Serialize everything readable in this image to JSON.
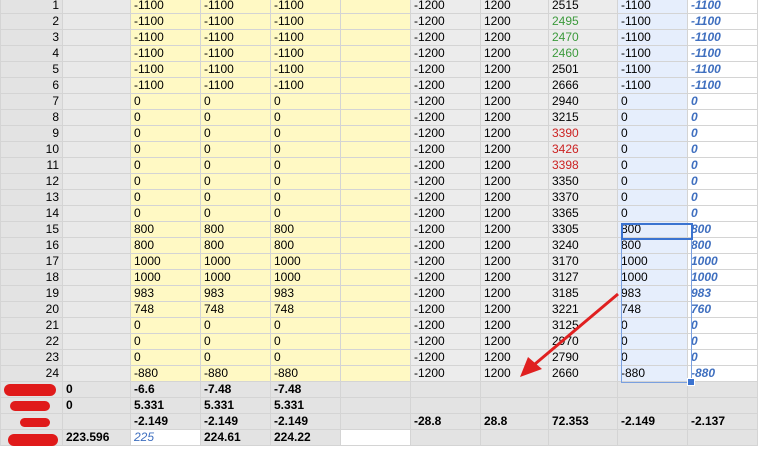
{
  "rows": [
    {
      "n": "1",
      "a": "-1100",
      "b": "-1100",
      "c": "-1100",
      "e": "-1200",
      "f": "1200",
      "g": "2515",
      "gc": "",
      "h": "-1100",
      "i": "-1100"
    },
    {
      "n": "2",
      "a": "-1100",
      "b": "-1100",
      "c": "-1100",
      "e": "-1200",
      "f": "1200",
      "g": "2495",
      "gc": "green",
      "h": "-1100",
      "i": "-1100"
    },
    {
      "n": "3",
      "a": "-1100",
      "b": "-1100",
      "c": "-1100",
      "e": "-1200",
      "f": "1200",
      "g": "2470",
      "gc": "green",
      "h": "-1100",
      "i": "-1100"
    },
    {
      "n": "4",
      "a": "-1100",
      "b": "-1100",
      "c": "-1100",
      "e": "-1200",
      "f": "1200",
      "g": "2460",
      "gc": "green",
      "h": "-1100",
      "i": "-1100"
    },
    {
      "n": "5",
      "a": "-1100",
      "b": "-1100",
      "c": "-1100",
      "e": "-1200",
      "f": "1200",
      "g": "2501",
      "gc": "",
      "h": "-1100",
      "i": "-1100"
    },
    {
      "n": "6",
      "a": "-1100",
      "b": "-1100",
      "c": "-1100",
      "e": "-1200",
      "f": "1200",
      "g": "2666",
      "gc": "",
      "h": "-1100",
      "i": "-1100"
    },
    {
      "n": "7",
      "a": "0",
      "b": "0",
      "c": "0",
      "e": "-1200",
      "f": "1200",
      "g": "2940",
      "gc": "",
      "h": "0",
      "i": "0"
    },
    {
      "n": "8",
      "a": "0",
      "b": "0",
      "c": "0",
      "e": "-1200",
      "f": "1200",
      "g": "3215",
      "gc": "",
      "h": "0",
      "i": "0"
    },
    {
      "n": "9",
      "a": "0",
      "b": "0",
      "c": "0",
      "e": "-1200",
      "f": "1200",
      "g": "3390",
      "gc": "red",
      "h": "0",
      "i": "0"
    },
    {
      "n": "10",
      "a": "0",
      "b": "0",
      "c": "0",
      "e": "-1200",
      "f": "1200",
      "g": "3426",
      "gc": "red",
      "h": "0",
      "i": "0"
    },
    {
      "n": "11",
      "a": "0",
      "b": "0",
      "c": "0",
      "e": "-1200",
      "f": "1200",
      "g": "3398",
      "gc": "red",
      "h": "0",
      "i": "0"
    },
    {
      "n": "12",
      "a": "0",
      "b": "0",
      "c": "0",
      "e": "-1200",
      "f": "1200",
      "g": "3350",
      "gc": "",
      "h": "0",
      "i": "0"
    },
    {
      "n": "13",
      "a": "0",
      "b": "0",
      "c": "0",
      "e": "-1200",
      "f": "1200",
      "g": "3370",
      "gc": "",
      "h": "0",
      "i": "0"
    },
    {
      "n": "14",
      "a": "0",
      "b": "0",
      "c": "0",
      "e": "-1200",
      "f": "1200",
      "g": "3365",
      "gc": "",
      "h": "0",
      "i": "0"
    },
    {
      "n": "15",
      "a": "800",
      "b": "800",
      "c": "800",
      "e": "-1200",
      "f": "1200",
      "g": "3305",
      "gc": "",
      "h": "800",
      "i": "800"
    },
    {
      "n": "16",
      "a": "800",
      "b": "800",
      "c": "800",
      "e": "-1200",
      "f": "1200",
      "g": "3240",
      "gc": "",
      "h": "800",
      "i": "800"
    },
    {
      "n": "17",
      "a": "1000",
      "b": "1000",
      "c": "1000",
      "e": "-1200",
      "f": "1200",
      "g": "3170",
      "gc": "",
      "h": "1000",
      "i": "1000"
    },
    {
      "n": "18",
      "a": "1000",
      "b": "1000",
      "c": "1000",
      "e": "-1200",
      "f": "1200",
      "g": "3127",
      "gc": "",
      "h": "1000",
      "i": "1000"
    },
    {
      "n": "19",
      "a": "983",
      "b": "983",
      "c": "983",
      "e": "-1200",
      "f": "1200",
      "g": "3185",
      "gc": "",
      "h": "983",
      "i": "983"
    },
    {
      "n": "20",
      "a": "748",
      "b": "748",
      "c": "748",
      "e": "-1200",
      "f": "1200",
      "g": "3221",
      "gc": "",
      "h": "748",
      "i": "760"
    },
    {
      "n": "21",
      "a": "0",
      "b": "0",
      "c": "0",
      "e": "-1200",
      "f": "1200",
      "g": "3125",
      "gc": "",
      "h": "0",
      "i": "0"
    },
    {
      "n": "22",
      "a": "0",
      "b": "0",
      "c": "0",
      "e": "-1200",
      "f": "1200",
      "g": "2970",
      "gc": "",
      "h": "0",
      "i": "0"
    },
    {
      "n": "23",
      "a": "0",
      "b": "0",
      "c": "0",
      "e": "-1200",
      "f": "1200",
      "g": "2790",
      "gc": "",
      "h": "0",
      "i": "0"
    },
    {
      "n": "24",
      "a": "-880",
      "b": "-880",
      "c": "-880",
      "e": "-1200",
      "f": "1200",
      "g": "2660",
      "gc": "",
      "h": "-880",
      "i": "-880"
    }
  ],
  "summary": [
    {
      "c0": "0",
      "a": "-6.6",
      "b": "-7.48",
      "c": "-7.48",
      "e": "",
      "f": "",
      "g": "",
      "h": "",
      "i": ""
    },
    {
      "c0": "0",
      "a": "5.331",
      "b": "5.331",
      "c": "5.331",
      "e": "",
      "f": "",
      "g": "",
      "h": "",
      "i": ""
    },
    {
      "c0": "",
      "a": "-2.149",
      "b": "-2.149",
      "c": "-2.149",
      "e": "-28.8",
      "f": "28.8",
      "g": "72.353",
      "h": "-2.149",
      "i": "-2.137"
    },
    {
      "c0": "223.596",
      "a": "225",
      "b": "224.61",
      "c": "224.22",
      "e": "",
      "f": "",
      "g": "",
      "h": "",
      "i": ""
    }
  ],
  "colors": {
    "selection": "#3b73d0",
    "highlight_yellow": "#fff9c4",
    "annotation_arrow": "#e02020",
    "redaction": "#e01a1a"
  }
}
